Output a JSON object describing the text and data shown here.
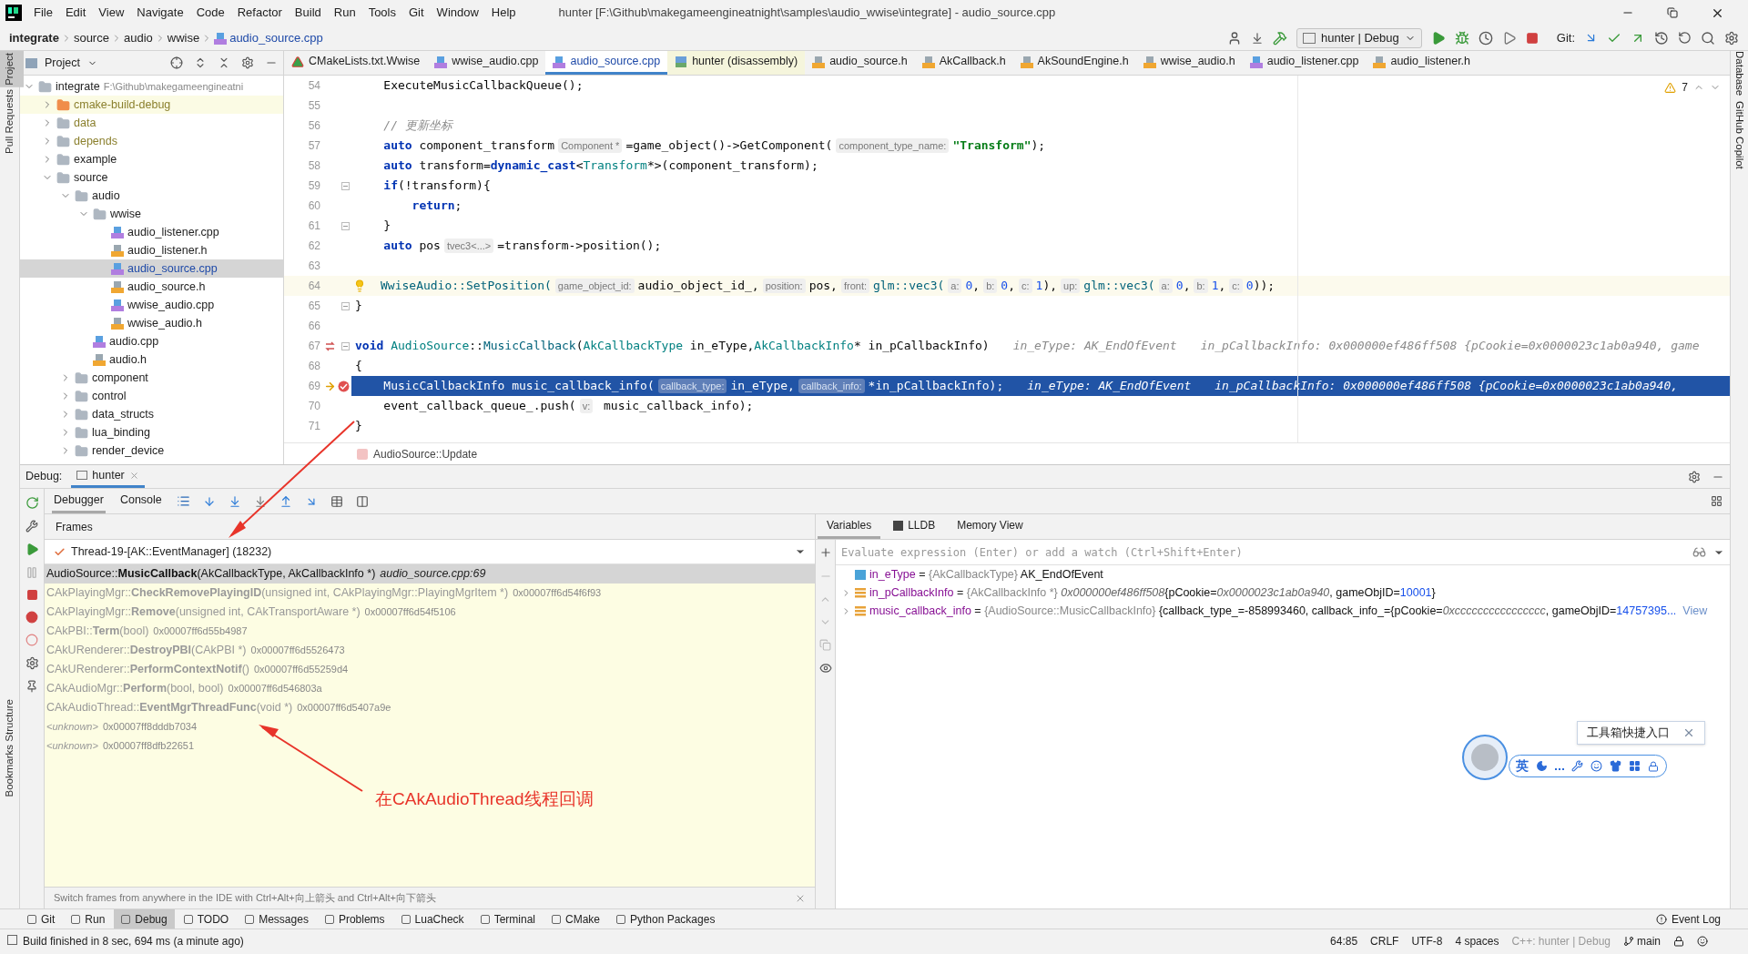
{
  "window_title": "hunter [F:\\Github\\makegameengineatnight\\samples\\audio_wwise\\integrate] - audio_source.cpp",
  "menu": [
    "File",
    "Edit",
    "View",
    "Navigate",
    "Code",
    "Refactor",
    "Build",
    "Run",
    "Tools",
    "Git",
    "Window",
    "Help"
  ],
  "breadcrumbs": [
    "integrate",
    "source",
    "audio",
    "wwise",
    "audio_source.cpp"
  ],
  "run_config": "hunter | Debug",
  "git_label": "Git:",
  "left_stripe": [
    {
      "label": "Project",
      "selected": true
    },
    {
      "label": "Pull Requests",
      "selected": false
    }
  ],
  "left_stripe_bottom": [
    "Structure",
    "Bookmarks"
  ],
  "right_stripe": [
    "Database",
    "GitHub Copilot"
  ],
  "project": {
    "title": "Project",
    "tree": [
      {
        "label": "integrate",
        "path": "F:\\Github\\makegameengineatni",
        "kind": "folder",
        "expanded": true,
        "selected": false,
        "children": [
          {
            "label": "cmake-build-debug",
            "kind": "build_folder",
            "expanded": false,
            "selected": false
          },
          {
            "label": "data",
            "kind": "ignored_folder",
            "expanded": false,
            "selected": false
          },
          {
            "label": "depends",
            "kind": "ignored_folder",
            "expanded": false,
            "selected": false
          },
          {
            "label": "example",
            "kind": "folder",
            "expanded": false,
            "selected": false
          },
          {
            "label": "source",
            "kind": "folder",
            "expanded": true,
            "selected": false,
            "children": [
              {
                "label": "audio",
                "kind": "folder",
                "expanded": true,
                "selected": false,
                "children": [
                  {
                    "label": "wwise",
                    "kind": "folder",
                    "expanded": true,
                    "selected": false,
                    "children": [
                      {
                        "label": "audio_listener.cpp",
                        "kind": "cpp",
                        "selected": false
                      },
                      {
                        "label": "audio_listener.h",
                        "kind": "h",
                        "selected": false
                      },
                      {
                        "label": "audio_source.cpp",
                        "kind": "cpp",
                        "selected": true
                      },
                      {
                        "label": "audio_source.h",
                        "kind": "h",
                        "selected": false
                      },
                      {
                        "label": "wwise_audio.cpp",
                        "kind": "cpp",
                        "selected": false
                      },
                      {
                        "label": "wwise_audio.h",
                        "kind": "h",
                        "selected": false
                      }
                    ]
                  },
                  {
                    "label": "audio.cpp",
                    "kind": "cpp",
                    "selected": false
                  },
                  {
                    "label": "audio.h",
                    "kind": "h",
                    "selected": false
                  }
                ]
              },
              {
                "label": "component",
                "kind": "folder",
                "expanded": false,
                "selected": false
              },
              {
                "label": "control",
                "kind": "folder",
                "expanded": false,
                "selected": false
              },
              {
                "label": "data_structs",
                "kind": "folder",
                "expanded": false,
                "selected": false
              },
              {
                "label": "lua_binding",
                "kind": "folder",
                "expanded": false,
                "selected": false
              },
              {
                "label": "render_device",
                "kind": "folder",
                "expanded": false,
                "selected": false
              }
            ]
          }
        ]
      }
    ]
  },
  "editor_tabs": [
    {
      "label": "CMakeLists.txt.Wwise",
      "kind": "cmake",
      "selected": false
    },
    {
      "label": "wwise_audio.cpp",
      "kind": "cpp",
      "selected": false
    },
    {
      "label": "audio_source.cpp",
      "kind": "cpp",
      "selected": true
    },
    {
      "label": "hunter (disassembly)",
      "kind": "asm",
      "selected": false
    },
    {
      "label": "audio_source.h",
      "kind": "h",
      "selected": false
    },
    {
      "label": "AkCallback.h",
      "kind": "h",
      "selected": false
    },
    {
      "label": "AkSoundEngine.h",
      "kind": "h",
      "selected": false
    },
    {
      "label": "wwise_audio.h",
      "kind": "h",
      "selected": false
    },
    {
      "label": "audio_listener.cpp",
      "kind": "cpp",
      "selected": false
    },
    {
      "label": "audio_listener.h",
      "kind": "h",
      "selected": false
    }
  ],
  "editor": {
    "warnings": "7",
    "breadcrumb": "AudioSource::Update",
    "lines": [
      {
        "number": "54",
        "kind": "normal",
        "tokens": [
          {
            "t": "    ExecuteMusicCallbackQueue();",
            "kind": "plain"
          }
        ]
      },
      {
        "number": "55",
        "kind": "normal"
      },
      {
        "number": "56",
        "kind": "normal",
        "tokens": [
          {
            "t": "    // 更新坐标",
            "kind": "comment"
          }
        ]
      },
      {
        "number": "57",
        "kind": "normal",
        "tokens": [
          {
            "t": "    auto",
            "kind": "keyword"
          },
          {
            "t": " component_transform",
            "kind": "plain"
          },
          {
            "t": "Component *",
            "kind": "hint"
          },
          {
            "t": "=game_object()->GetComponent(",
            "kind": "plain"
          },
          {
            "t": "component_type_name:",
            "kind": "hint"
          },
          {
            "t": "\"Transform\"",
            "kind": "string"
          },
          {
            "t": ");",
            "kind": "plain"
          }
        ]
      },
      {
        "number": "58",
        "kind": "normal",
        "tokens": [
          {
            "t": "    auto",
            "kind": "keyword"
          },
          {
            "t": " transform=",
            "kind": "plain"
          },
          {
            "t": "dynamic_cast",
            "kind": "keyword"
          },
          {
            "t": "<",
            "kind": "plain"
          },
          {
            "t": "Transform",
            "kind": "type"
          },
          {
            "t": "*>(component_transform);",
            "kind": "plain"
          }
        ]
      },
      {
        "number": "59",
        "kind": "normal",
        "markers": [
          {
            "kind": "fold"
          }
        ],
        "tokens": [
          {
            "t": "    if",
            "kind": "keyword"
          },
          {
            "t": "(!transform){",
            "kind": "plain"
          }
        ]
      },
      {
        "number": "60",
        "kind": "normal",
        "tokens": [
          {
            "t": "        return",
            "kind": "keyword"
          },
          {
            "t": ";",
            "kind": "plain"
          }
        ]
      },
      {
        "number": "61",
        "kind": "normal",
        "markers": [
          {
            "kind": "fold"
          }
        ],
        "tokens": [
          {
            "t": "    }",
            "kind": "plain"
          }
        ]
      },
      {
        "number": "62",
        "kind": "normal",
        "tokens": [
          {
            "t": "    auto",
            "kind": "keyword"
          },
          {
            "t": " pos",
            "kind": "plain"
          },
          {
            "t": "tvec3<...>",
            "kind": "hint"
          },
          {
            "t": "=transform->position();",
            "kind": "plain"
          }
        ]
      },
      {
        "number": "63",
        "kind": "normal"
      },
      {
        "number": "64",
        "kind": "caret",
        "markers": [
          {
            "kind": "bulb"
          }
        ],
        "tokens": [
          {
            "t": "WwiseAudio::SetPosition(",
            "kind": "func"
          },
          {
            "t": "game_object_id:",
            "kind": "hint"
          },
          {
            "t": "audio_object_id_,",
            "kind": "plain"
          },
          {
            "t": "position:",
            "kind": "hint"
          },
          {
            "t": "pos,",
            "kind": "plain"
          },
          {
            "t": "front:",
            "kind": "hint"
          },
          {
            "t": "glm::vec3(",
            "kind": "func"
          },
          {
            "t": "a:",
            "kind": "hint"
          },
          {
            "t": "0",
            "kind": "number"
          },
          {
            "t": ",",
            "kind": "plain"
          },
          {
            "t": "b:",
            "kind": "hint"
          },
          {
            "t": "0",
            "kind": "number"
          },
          {
            "t": ",",
            "kind": "plain"
          },
          {
            "t": "c:",
            "kind": "hint"
          },
          {
            "t": "1",
            "kind": "number"
          },
          {
            "t": "),",
            "kind": "plain"
          },
          {
            "t": "up:",
            "kind": "hint"
          },
          {
            "t": "glm::vec3(",
            "kind": "func"
          },
          {
            "t": "a:",
            "kind": "hint"
          },
          {
            "t": "0",
            "kind": "number"
          },
          {
            "t": ",",
            "kind": "plain"
          },
          {
            "t": "b:",
            "kind": "hint"
          },
          {
            "t": "1",
            "kind": "number"
          },
          {
            "t": ",",
            "kind": "plain"
          },
          {
            "t": "c:",
            "kind": "hint"
          },
          {
            "t": "0",
            "kind": "number"
          },
          {
            "t": "));",
            "kind": "plain"
          }
        ]
      },
      {
        "number": "65",
        "kind": "normal",
        "markers": [
          {
            "kind": "fold"
          }
        ],
        "tokens": [
          {
            "t": "}",
            "kind": "plain"
          }
        ]
      },
      {
        "number": "66",
        "kind": "normal"
      },
      {
        "number": "67",
        "kind": "normal",
        "markers": [
          {
            "kind": "override"
          },
          {
            "kind": "fold"
          }
        ],
        "tokens": [
          {
            "t": "void",
            "kind": "keyword"
          },
          {
            "t": " AudioSource",
            "kind": "type"
          },
          {
            "t": "::",
            "kind": "plain"
          },
          {
            "t": "MusicCallback",
            "kind": "func"
          },
          {
            "t": "(",
            "kind": "plain"
          },
          {
            "t": "AkCallbackType",
            "kind": "type"
          },
          {
            "t": " in_eType,",
            "kind": "plain"
          },
          {
            "t": "AkCallbackInfo",
            "kind": "type"
          },
          {
            "t": "* in_pCallbackInfo)",
            "kind": "plain"
          },
          {
            "t": "in_eType: AK_EndOfEvent",
            "kind": "debug"
          },
          {
            "t": "in_pCallbackInfo: 0x000000ef486ff508 {pCookie=0x0000023c1ab0a940, game",
            "kind": "debug"
          }
        ]
      },
      {
        "number": "68",
        "kind": "normal",
        "tokens": [
          {
            "t": "{",
            "kind": "plain"
          }
        ]
      },
      {
        "number": "69",
        "kind": "execution",
        "markers": [
          {
            "kind": "execution_arrow"
          },
          {
            "kind": "breakpoint"
          }
        ],
        "tokens": [
          {
            "t": "    MusicCallbackInfo music_callback_info(",
            "kind": "plain"
          },
          {
            "t": "callback_type:",
            "kind": "hint"
          },
          {
            "t": "in_eType,",
            "kind": "plain"
          },
          {
            "t": "callback_info:",
            "kind": "hint"
          },
          {
            "t": "*in_pCallbackInfo);",
            "kind": "plain"
          },
          {
            "t": "in_eType: AK_EndOfEvent",
            "kind": "debug"
          },
          {
            "t": "in_pCallbackInfo: 0x000000ef486ff508 {pCookie=0x0000023c1ab0a940,",
            "kind": "debug"
          }
        ]
      },
      {
        "number": "70",
        "kind": "normal",
        "tokens": [
          {
            "t": "    event_callback_queue_.push(",
            "kind": "plain"
          },
          {
            "t": "v:",
            "kind": "hint"
          },
          {
            "t": " music_callback_info);",
            "kind": "plain"
          }
        ]
      },
      {
        "number": "71",
        "kind": "normal",
        "tokens": [
          {
            "t": "}",
            "kind": "plain"
          }
        ]
      }
    ]
  },
  "debug": {
    "label": "Debug:",
    "session": "hunter",
    "tabs": [
      {
        "label": "Debugger",
        "selected": true
      },
      {
        "label": "Console",
        "selected": false
      }
    ],
    "frames_title": "Frames",
    "thread": "Thread-19-[AK::EventManager] (18232)",
    "frames": [
      {
        "text": "AudioSource::**MusicCallback**(AkCallbackType, AkCallbackInfo *)",
        "location": "audio_source.cpp:69",
        "kind": "source",
        "selected": true
      },
      {
        "text": "CAkPlayingMgr::**CheckRemovePlayingID**(unsigned int, CAkPlayingMgr::PlayingMgrItem *)",
        "address": "0x00007ff6d54f6f93",
        "kind": "library",
        "selected": false
      },
      {
        "text": "CAkPlayingMgr::**Remove**(unsigned int, CAkTransportAware *)",
        "address": "0x00007ff6d54f5106",
        "kind": "library",
        "selected": false
      },
      {
        "text": "CAkPBI::**Term**(bool)",
        "address": "0x00007ff6d55b4987",
        "kind": "library",
        "selected": false
      },
      {
        "text": "CAkURenderer::**DestroyPBI**(CAkPBI *)",
        "address": "0x00007ff6d5526473",
        "kind": "library",
        "selected": false
      },
      {
        "text": "CAkURenderer::**PerformContextNotif**()",
        "address": "0x00007ff6d55259d4",
        "kind": "library",
        "selected": false
      },
      {
        "text": "CAkAudioMgr::**Perform**(bool, bool)",
        "address": "0x00007ff6d546803a",
        "kind": "library",
        "selected": false
      },
      {
        "text": "CAkAudioThread::**EventMgrThreadFunc**(void *)",
        "address": "0x00007ff6d5407a9e",
        "kind": "library",
        "selected": false
      },
      {
        "text": "<unknown>",
        "address": "0x00007ff8dddb7034",
        "kind": "unknown",
        "selected": false
      },
      {
        "text": "<unknown>",
        "address": "0x00007ff8dfb22651",
        "kind": "unknown",
        "selected": false
      }
    ],
    "frames_hint": "Switch frames from anywhere in the IDE with Ctrl+Alt+向上箭头 and Ctrl+Alt+向下箭头",
    "variable_tabs": [
      {
        "label": "Variables",
        "selected": true
      },
      {
        "label": "LLDB",
        "selected": false
      },
      {
        "label": "Memory View",
        "selected": false
      }
    ],
    "evaluate": {
      "placeholder": "Evaluate expression (Enter) or add a watch (Ctrl+Shift+Enter)"
    },
    "variables": [
      {
        "name": "in_eType",
        "equals": "=",
        "type": "{AkCallbackType}",
        "kind": "enum",
        "expandable": false,
        "value": [
          {
            "t": "AK_EndOfEvent",
            "kind": "plain"
          }
        ]
      },
      {
        "name": "in_pCallbackInfo",
        "equals": "=",
        "type": "{AkCallbackInfo *}",
        "kind": "struct",
        "expandable": true,
        "value": [
          {
            "t": "0x000000ef486ff508",
            "kind": "address"
          },
          {
            "t": "{pCookie=",
            "kind": "plain"
          },
          {
            "t": "0x0000023c1ab0a940",
            "kind": "address"
          },
          {
            "t": ", gameObjID=",
            "kind": "plain"
          },
          {
            "t": "10001",
            "kind": "number"
          },
          {
            "t": "}",
            "kind": "plain"
          }
        ]
      },
      {
        "name": "music_callback_info",
        "equals": "=",
        "type": "{AudioSource::MusicCallbackInfo}",
        "kind": "struct",
        "expandable": true,
        "value": [
          {
            "t": "{callback_type_=-858993460, callback_info_={pCookie=",
            "kind": "plain"
          },
          {
            "t": "0xcccccccccccccccc",
            "kind": "address"
          },
          {
            "t": ", gameObjID=",
            "kind": "plain"
          },
          {
            "t": "14757395...",
            "kind": "number"
          }
        ],
        "link": "View"
      }
    ]
  },
  "annotation": "在CAkAudioThread线程回调",
  "ime": {
    "tooltip": "工具箱快捷入口",
    "mode": "英"
  },
  "bottom_tabs": [
    {
      "label": "Git",
      "selected": false
    },
    {
      "label": "Run",
      "selected": false
    },
    {
      "label": "Debug",
      "selected": true
    },
    {
      "label": "TODO",
      "selected": false
    },
    {
      "label": "Messages",
      "selected": false
    },
    {
      "label": "Problems",
      "selected": false
    },
    {
      "label": "LuaCheck",
      "selected": false
    },
    {
      "label": "Terminal",
      "selected": false
    },
    {
      "label": "CMake",
      "selected": false
    },
    {
      "label": "Python Packages",
      "selected": false
    }
  ],
  "event_log": "Event Log",
  "status": {
    "message": "Build finished in 8 sec, 694 ms (a minute ago)",
    "items": [
      "64:85",
      "CRLF",
      "UTF-8",
      "4 spaces",
      "C++: hunter | Debug"
    ],
    "branch": "main"
  }
}
